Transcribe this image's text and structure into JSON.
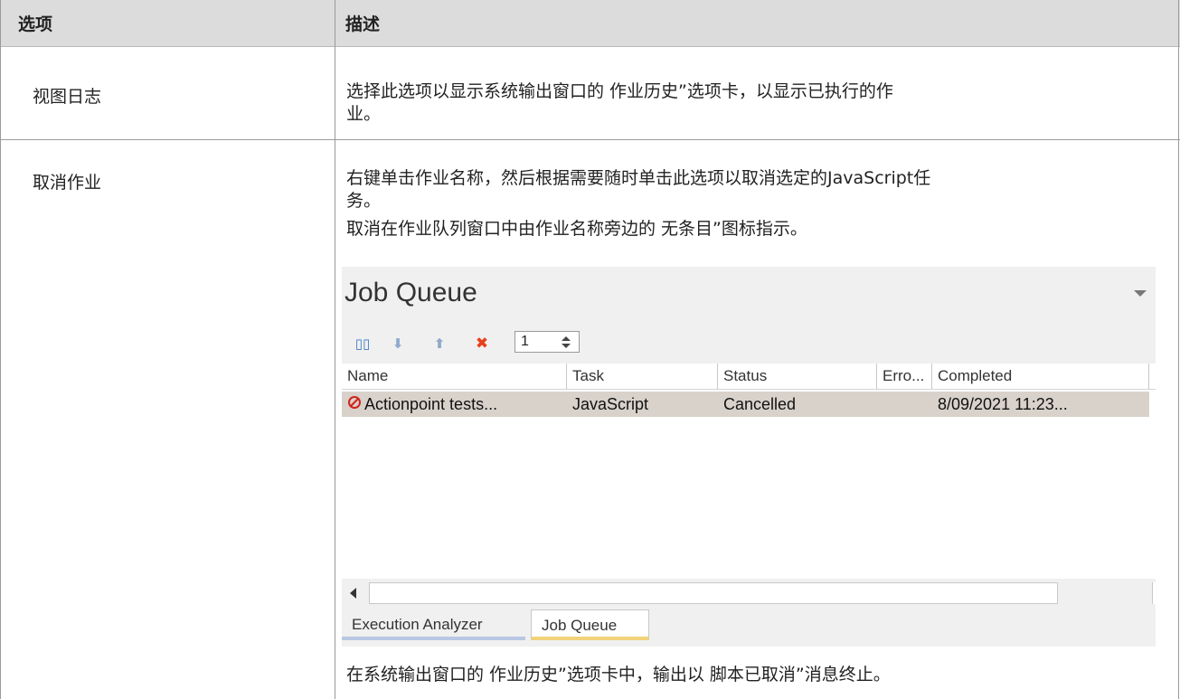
{
  "table": {
    "header": {
      "option": "选项",
      "description": "描述"
    },
    "rows": [
      {
        "option": "视图日志",
        "description": [
          "选择此选项以显示系统输出窗口的 作业历史”选项卡，以显示已执行的作",
          "业。"
        ]
      },
      {
        "option": "取消作业",
        "description": [
          "右键单击作业名称，然后根据需要随时单击此选项以取消选定的JavaScript任",
          "务。",
          "取消在作业队列窗口中由作业名称旁边的 无条目”图标指示。",
          "在系统输出窗口的 作业历史”选项卡中，输出以 脚本已取消”消息终止。"
        ]
      }
    ]
  },
  "job_queue": {
    "title": "Job Queue",
    "toolbar": {
      "icons": [
        "pause-icon",
        "arrow-down-icon",
        "arrow-up-icon",
        "delete-icon"
      ],
      "glyphs": [
        "▯▯",
        "⬇",
        "⬆",
        "✖"
      ],
      "colors": [
        "#3a78c3",
        "#8fa9cc",
        "#8fa9cc",
        "#e8401c"
      ],
      "spinner_value": "1"
    },
    "columns": [
      "Name",
      "Task",
      "Status",
      "Erro...",
      "Completed"
    ],
    "rows": [
      {
        "status_icon": "cancelled-icon",
        "name": "Actionpoint tests...",
        "task": "JavaScript",
        "status": "Cancelled",
        "error": "",
        "completed": "8/09/2021 11:23..."
      }
    ],
    "tabs": [
      "Execution Analyzer",
      "Job Queue"
    ],
    "active_tab": "Job Queue"
  }
}
